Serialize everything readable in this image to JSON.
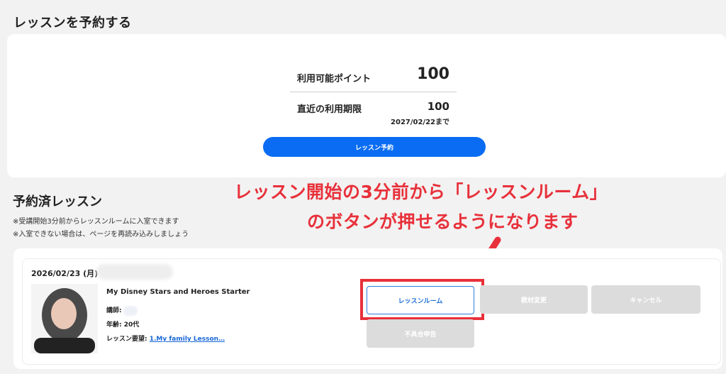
{
  "reserve": {
    "heading": "レッスンを予約する",
    "points_label": "利用可能ポイント",
    "points_value": "100",
    "expiry_label": "直近の利用期限",
    "expiry_value": "100",
    "expiry_date": "2027/02/22まで",
    "reserve_button": "レッスン予約"
  },
  "booked": {
    "heading": "予約済レッスン",
    "notes": [
      "※受講開始3分前からレッスンルームに入室できます",
      "※入室できない場合は、ページを再読み込みしましょう"
    ],
    "lesson": {
      "date": "2026/02/23 (月)",
      "course": "My Disney Stars and Heroes Starter",
      "teacher_label": "講師:",
      "age": "年齢: 20代",
      "request_label": "レッスン要望:",
      "request_link": "1.My family Lesson…"
    },
    "buttons": {
      "room": "レッスンルーム",
      "material": "教材変更",
      "cancel": "キャンセル",
      "report": "不具合申告"
    }
  },
  "annotation": {
    "line1": "レッスン開始の3分前から「レッスンルーム」",
    "line2": "のボタンが押せるようになります",
    "color": "#e8313b"
  },
  "colors": {
    "accent": "#0a6cf2",
    "disabled": "#dcdcdc",
    "link": "#1866d6"
  }
}
